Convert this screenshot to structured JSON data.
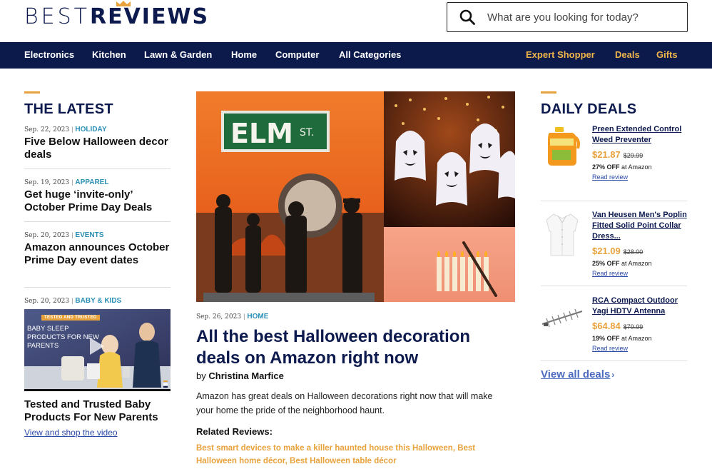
{
  "logo": {
    "part1": "BEST",
    "part2": "REVIEWS"
  },
  "search": {
    "placeholder": "What are you looking for today?"
  },
  "nav": {
    "left": [
      "Electronics",
      "Kitchen",
      "Lawn & Garden",
      "Home",
      "Computer",
      "All Categories"
    ],
    "right": [
      "Expert Shopper",
      "Deals",
      "Gifts"
    ]
  },
  "latest": {
    "heading": "THE LATEST",
    "items": [
      {
        "date": "Sep. 22, 2023",
        "category": "HOLIDAY",
        "title": "Five Below Halloween decor deals"
      },
      {
        "date": "Sep. 19, 2023",
        "category": "APPAREL",
        "title": "Get huge ‘invite-only’ October Prime Day Deals"
      },
      {
        "date": "Sep. 20, 2023",
        "category": "EVENTS",
        "title": "Amazon announces October Prime Day event dates"
      },
      {
        "date": "Sep. 20, 2023",
        "category": "BABY & KIDS",
        "title": "Tested and Trusted Baby Products For New Parents",
        "link": "View and shop the video",
        "thumb_badge": "TESTED AND TRUSTED",
        "thumb_text": "BABY SLEEP PRODUCTS FOR NEW PARENTS"
      }
    ]
  },
  "main": {
    "date": "Sep. 26, 2023",
    "category": "HOME",
    "title": "All the best Halloween decoration deals on Amazon right now",
    "byline_prefix": "by",
    "author": "Christina Marfice",
    "excerpt": "Amazon has great deals on Halloween decorations right now that will make your home the pride of the neighborhood haunt.",
    "related_label": "Related Reviews:",
    "related_links": "Best smart devices to make a killer haunted house this Halloween, Best Halloween home décor, Best Halloween table décor",
    "sign_text": "ELM",
    "sign_suffix": "ST."
  },
  "deals": {
    "heading": "DAILY DEALS",
    "items": [
      {
        "name": "Preen Extended Control Weed Preventer",
        "price": "$21.87",
        "was": "$29.99",
        "off": "27% OFF",
        "store": "at Amazon",
        "review": "Read review",
        "icon": "weed-preventer-jug"
      },
      {
        "name": "Van Heusen Men's Poplin Fitted Solid Point Collar Dress...",
        "price": "$21.09",
        "was": "$28.00",
        "off": "25% OFF",
        "store": "at Amazon",
        "review": "Read review",
        "icon": "dress-shirt"
      },
      {
        "name": "RCA Compact Outdoor Yagi HDTV Antenna",
        "price": "$64.84",
        "was": "$79.99",
        "off": "19% OFF",
        "store": "at Amazon",
        "review": "Read review",
        "icon": "antenna"
      }
    ],
    "view_all": "View all deals",
    "view_all_arrow": "›"
  },
  "colors": {
    "navy": "#0b1a4b",
    "gold": "#e8a23c",
    "teal": "#2c8fb5",
    "link": "#2a4aa8"
  }
}
